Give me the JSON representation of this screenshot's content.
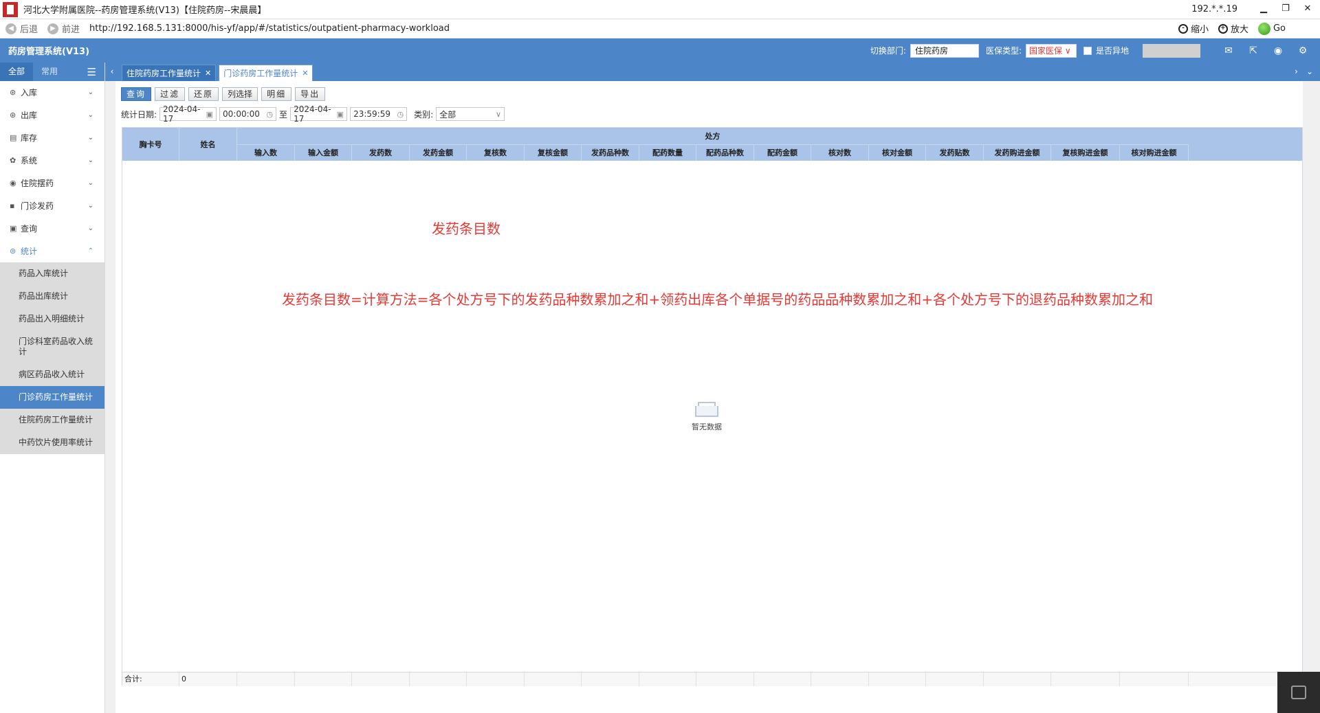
{
  "window": {
    "title": "河北大学附属医院--药房管理系统(V13)【住院药房--宋晨晨】",
    "ip": "192.*.*.19",
    "minimize": "▁",
    "restore": "❐",
    "close": "✕"
  },
  "browser": {
    "back": "后退",
    "forward": "前进",
    "url": "http://192.168.5.131:8000/his-yf/app/#/statistics/outpatient-pharmacy-workload",
    "zoom_out": "缩小",
    "zoom_in": "放大",
    "go": "Go"
  },
  "header": {
    "system_title": "药房管理系统(V13)",
    "dept_label": "切换部门:",
    "dept_value": "住院药房",
    "insurance_label": "医保类型:",
    "insurance_value": "国家医保",
    "remote_label": "是否异地"
  },
  "sidebar": {
    "tab_all": "全部",
    "tab_common": "常用",
    "menu": [
      {
        "label": "入库",
        "icon": "⊛"
      },
      {
        "label": "出库",
        "icon": "⊛"
      },
      {
        "label": "库存",
        "icon": "▤"
      },
      {
        "label": "系统",
        "icon": "✿"
      },
      {
        "label": "住院摆药",
        "icon": "◉"
      },
      {
        "label": "门诊发药",
        "icon": "▪"
      },
      {
        "label": "查询",
        "icon": "▣"
      },
      {
        "label": "统计",
        "icon": "⊜"
      }
    ],
    "submenu": [
      "药品入库统计",
      "药品出库统计",
      "药品出入明细统计",
      "门诊科室药品收入统计",
      "病区药品收入统计",
      "门诊药房工作量统计",
      "住院药房工作量统计",
      "中药饮片使用率统计"
    ]
  },
  "tabs": [
    {
      "label": "住院药房工作量统计",
      "active": false
    },
    {
      "label": "门诊药房工作量统计",
      "active": true
    }
  ],
  "toolbar": {
    "query": "查询",
    "filter": "过滤",
    "restore": "还原",
    "column_select": "列选择",
    "detail": "明细",
    "export": "导出"
  },
  "filter": {
    "date_label": "统计日期:",
    "start_date": "2024-04-17",
    "start_time": "00:00:00",
    "to": "至",
    "end_date": "2024-04-17",
    "end_time": "23:59:59",
    "category_label": "类别:",
    "category_value": "全部"
  },
  "grid": {
    "col_card": "胸卡号",
    "col_name": "姓名",
    "group_label": "处方",
    "sub_columns": [
      "输入数",
      "输入金额",
      "发药数",
      "发药金额",
      "复核数",
      "复核金额",
      "发药品种数",
      "配药数量",
      "配药品种数",
      "配药金额",
      "核对数",
      "核对金额",
      "发药贴数",
      "发药购进金额",
      "复核购进金额",
      "核对购进金额"
    ],
    "empty_text": "暂无数据",
    "footer_label": "合计:",
    "footer_value": "0"
  },
  "annotations": {
    "small": "发药条目数",
    "big": "发药条目数=计算方法=各个处方号下的发药品种数累加之和+领药出库各个单据号的药品品种数累加之和+各个处方号下的退药品种数累加之和"
  },
  "colors": {
    "primary": "#4d86c8",
    "header_grid": "#a9c4e8",
    "annotation": "#e53935"
  }
}
